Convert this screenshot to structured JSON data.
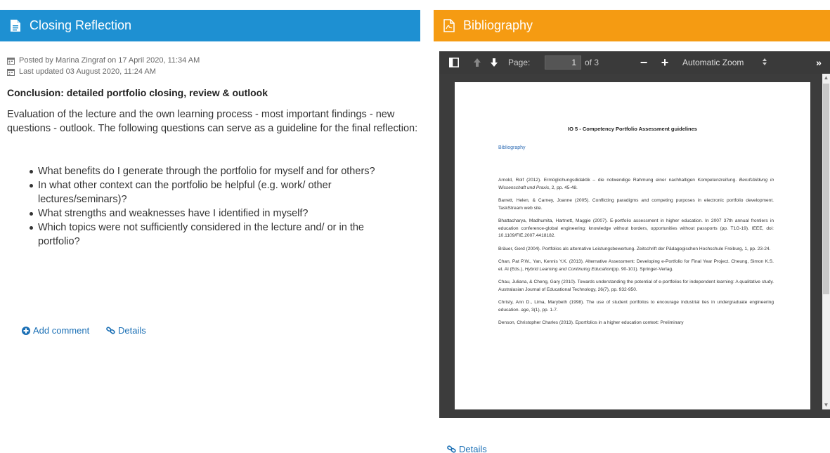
{
  "left_panel": {
    "header_title": "Closing Reflection",
    "posted_by": "Posted by Marina Zingraf on 17 April 2020, 11:34 AM",
    "last_updated": "Last updated 03 August 2020, 11:24 AM",
    "entry_title": "Conclusion: detailed portfolio closing, review & outlook",
    "entry_body": "Evaluation of the lecture and the own learning process - most important findings - new questions - outlook. The following questions can serve as a guideline for the final reflection:",
    "questions": [
      "What benefits do I generate through the portfolio for myself and for others?",
      "In what other context can the portfolio be helpful (e.g. work/ other lectures/seminars)?",
      "What strengths and weaknesses have I identified in myself?",
      "Which topics were not sufficiently considered in the lecture and/ or in the portfolio?"
    ],
    "add_comment_label": "Add comment",
    "details_label": "Details"
  },
  "right_panel": {
    "header_title": "Bibliography",
    "details_label": "Details",
    "viewer": {
      "page_label": "Page:",
      "page_value": "1",
      "page_of": "of 3",
      "zoom_label": "Automatic Zoom",
      "zoom_out": "−",
      "zoom_in": "+",
      "tools": "»"
    },
    "document": {
      "title": "IO 5 -  Competency Portfolio Assessment guidelines",
      "section": "Bibliography",
      "references": [
        {
          "text": "Arnold, Rolf (2012). Ermöglichungsdidaktik – die notwendige Rahmung einer nachhaltigen Kompetenzreifung. ",
          "italic": "Berufsbildung in Wissenschaft und Praxis",
          "tail": ", 2, pp. 45-48."
        },
        {
          "text": "Barrett, Helen, & Carney, Joanne (2005). Conflicting paradigms and competing purposes in electronic portfolio development. TaskStream web site.",
          "italic": "",
          "tail": ""
        },
        {
          "text": "Bhattacharya, Madhumita, Hartnett, Maggie (2007). E-portfolio assessment in higher education. In 2007 37th annual frontiers in education conference-global engineering: knowledge without borders, opportunities without passports (pp. T1G-19). IEEE, doi: 10.1109/FIE.2007.4418182.",
          "italic": "",
          "tail": ""
        },
        {
          "text": "Bräuer, Gerd (2004). Portfolios als alternative Leistungsbewertung. Zeitschrift der Pädagogischen Hochschule Freiburg, 1, pp. 23-24.",
          "italic": "",
          "tail": ""
        },
        {
          "text": "Chan, Pat P.W., Yan, Kennis Y.K. (2013). Alternative Assessment: Developing e-Portfolio for Final Year Project. Cheung, Simon K.S. et. Al (Eds.), ",
          "italic": "Hybrid Learning and Continuing Education",
          "tail": "(pp. 90-101). Springer-Verlag."
        },
        {
          "text": "Chau, Juliana, & Cheng, Gary (2010). Towards understanding the potential of e-portfolios for independent learning: A qualitative study. Australasian Journal of Educational Technology, 26(7), pp. 932-950.",
          "italic": "",
          "tail": ""
        },
        {
          "text": "Christy, Ann D., Lima, Marybeth (1998). The use of student portfolios to encourage industrial ties in undergraduate engineering education. ",
          "italic": "age",
          "tail": ", 3(1), pp. 1-7."
        },
        {
          "text": "Denson, Christopher Charles (2013). Eportfolios in a higher education context: Preliminary",
          "italic": "",
          "tail": ""
        }
      ]
    }
  },
  "colors": {
    "left_header": "#1e90d2",
    "right_header": "#f59b12",
    "link": "#1a6fb5",
    "viewer_bg": "#3c3c3c"
  }
}
